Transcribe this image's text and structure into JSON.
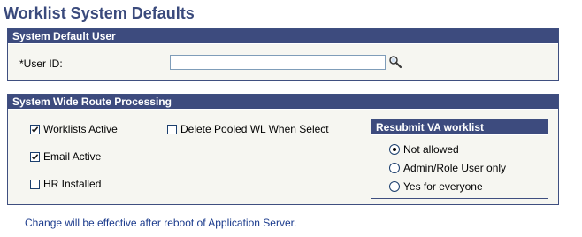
{
  "page": {
    "title": "Worklist System Defaults",
    "footer_note": "Change will be effective after reboot of Application Server."
  },
  "default_user": {
    "header": "System Default User",
    "user_id_label": "*User ID:",
    "user_id_value": "",
    "lookup_icon": "magnifier-icon"
  },
  "route_processing": {
    "header": "System Wide Route Processing",
    "worklists_active": {
      "label": "Worklists Active",
      "checked": true
    },
    "email_active": {
      "label": "Email Active",
      "checked": true
    },
    "hr_installed": {
      "label": "HR Installed",
      "checked": false
    },
    "delete_pooled": {
      "label": "Delete Pooled WL When Select",
      "checked": false
    },
    "resubmit": {
      "header": "Resubmit VA worklist",
      "options": [
        {
          "label": "Not allowed",
          "selected": true
        },
        {
          "label": "Admin/Role User only",
          "selected": false
        },
        {
          "label": "Yes for everyone",
          "selected": false
        }
      ]
    }
  },
  "colors": {
    "header_bg": "#3d4b7e",
    "title_text": "#3a4a7c",
    "group_bg": "#f6f6f1",
    "note_text": "#1a3a8c"
  }
}
